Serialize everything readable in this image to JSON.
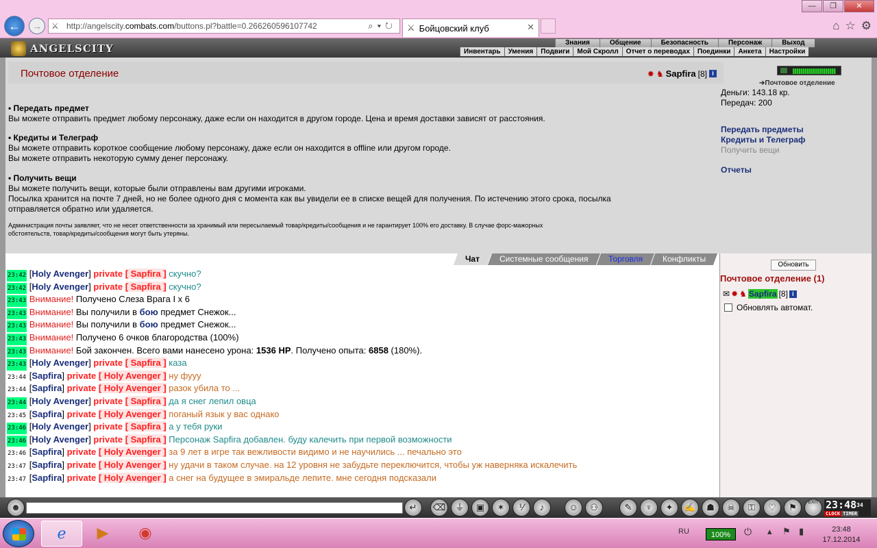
{
  "browser": {
    "url_prefix": "http://angelscity.",
    "url_host": "combats.com",
    "url_rest": "/buttons.pl?battle=0.266260596107742",
    "tab_title": "Бойцовский клуб"
  },
  "game": {
    "logo": "ANGELSCITY",
    "main_menu": [
      "Знания",
      "Общение",
      "Безопасность",
      "Персонаж",
      "Выход"
    ],
    "sub_menu": [
      "Инвентарь",
      "Умения",
      "Подвиги",
      "Мой Скролл",
      "Отчет о переводах",
      "Поединки",
      "Анкета",
      "Настройки"
    ]
  },
  "page": {
    "title": "Почтовое отделение",
    "player_name": "Sapfira",
    "player_level": "[8]",
    "info": "i",
    "sections": [
      {
        "heading": "• Передать предмет",
        "lines": [
          "Вы можете отправить предмет любому персонажу, даже если он находится в другом городе. Цена и время доставки зависят от расстояния."
        ]
      },
      {
        "heading": "• Кредиты и Телеграф",
        "lines": [
          "Вы можете отправить короткое сообщение любому персонажу, даже если он находится в offline или другом городе.",
          "Вы можете отправить некоторую сумму денег персонажу."
        ]
      },
      {
        "heading": "• Получить вещи",
        "lines": [
          "Вы можете получить вещи, которые были отправлены вам другими игроками.",
          "Посылка хранится на почте 7 дней, но не более одного дня с момента как вы увидели ее в списке вещей для получения. По истечению этого срока, посылка",
          "отправляется обратно или удаляется."
        ]
      }
    ],
    "disclaimer_1": "Администрация почты заявляет, что не несет ответственности за хранимый или пересылаемый товар/кредиты/сообщения и не гарантирует 100% его доставку. В случае форс-мажорных",
    "disclaimer_2": "обстоятельств, товар/кредиты/сообщения могут быть утеряны."
  },
  "side": {
    "hp_fill": 0.92,
    "location_tag": "Почтовое отделение",
    "money": "Деньги: 143.18 кр.",
    "transfers": "Передач: 200",
    "link_transfer": "Передать предметы",
    "link_credits": "Кредиты и Телеграф",
    "link_receive": "Получить вещи",
    "link_reports": "Отчеты"
  },
  "chat": {
    "tabs": [
      "Чат",
      "Системные сообщения",
      "Торговля",
      "Конфликты"
    ],
    "messages": [
      {
        "ts": "23:42",
        "green": true,
        "type": "to",
        "from": "Holy Avenger",
        "to": "Sapfira",
        "text": "скучно?",
        "color": "teal"
      },
      {
        "ts": "23:42",
        "green": true,
        "type": "to",
        "from": "Holy Avenger",
        "to": "Sapfira",
        "text": "скучно?",
        "color": "teal"
      },
      {
        "ts": "23:43",
        "green": true,
        "type": "warn",
        "text": "Получено Слеза Врага I x 6"
      },
      {
        "ts": "23:43",
        "green": true,
        "type": "warn_boy",
        "pre": "Вы получили в ",
        "boy": "бою",
        "post": " предмет Снежок..."
      },
      {
        "ts": "23:43",
        "green": true,
        "type": "warn_boy",
        "pre": "Вы получили в ",
        "boy": "бою",
        "post": " предмет Снежок..."
      },
      {
        "ts": "23:43",
        "green": true,
        "type": "warn",
        "text": "Получено 6 очков благородства (100%)"
      },
      {
        "ts": "23:43",
        "green": true,
        "type": "warn_battle",
        "pre": "Бой закончен. Всего вами нанесено урона: ",
        "dmg": "1536 HP",
        "mid": ". Получено опыта: ",
        "exp": "6858",
        "post": " (180%)."
      },
      {
        "ts": "23:43",
        "green": true,
        "type": "to",
        "from": "Holy Avenger",
        "to": "Sapfira",
        "text": "каза",
        "color": "teal"
      },
      {
        "ts": "23:44",
        "green": false,
        "type": "to",
        "from": "Sapfira",
        "to": "Holy Avenger",
        "text": "ну фууу",
        "color": "orange"
      },
      {
        "ts": "23:44",
        "green": false,
        "type": "to",
        "from": "Sapfira",
        "to": "Holy Avenger",
        "text": "разок убила то ...",
        "color": "orange"
      },
      {
        "ts": "23:44",
        "green": true,
        "type": "to",
        "from": "Holy Avenger",
        "to": "Sapfira",
        "text": "да я снег лепил овца",
        "color": "teal"
      },
      {
        "ts": "23:45",
        "green": false,
        "type": "to",
        "from": "Sapfira",
        "to": "Holy Avenger",
        "text": "поганый язык у вас однако",
        "color": "orange"
      },
      {
        "ts": "23:46",
        "green": true,
        "type": "to",
        "from": "Holy Avenger",
        "to": "Sapfira",
        "text": "а у тебя руки",
        "color": "teal"
      },
      {
        "ts": "23:46",
        "green": true,
        "type": "to",
        "from": "Holy Avenger",
        "to": "Sapfira",
        "text": "Персонаж Sapfira добавлен. буду калечить при первой возможности",
        "color": "teal"
      },
      {
        "ts": "23:46",
        "green": false,
        "type": "to",
        "from": "Sapfira",
        "to": "Holy Avenger",
        "text": "за 9 лет в игре так вежливости видимо и не научились ... печально это",
        "color": "orange"
      },
      {
        "ts": "23:47",
        "green": false,
        "type": "to",
        "from": "Sapfira",
        "to": "Holy Avenger",
        "text": "ну удачи в таком случае. на 12 уровня не забудьте переключится, чтобы уж наверняка искалечить",
        "color": "orange"
      },
      {
        "ts": "23:47",
        "green": false,
        "type": "to",
        "from": "Sapfira",
        "to": "Holy Avenger",
        "text": "а снег на будущее в эмиральде лепите. мне сегодня подсказали",
        "color": "orange"
      }
    ],
    "warning_label": "Внимание!",
    "private_label": "private",
    "refresh": "Обновить",
    "room_title": "Почтовое отделение (1)",
    "room_user": "Sapfira",
    "room_user_level": "[8]",
    "auto_refresh": "Обновлять автомат."
  },
  "clock": {
    "time": "23:48",
    "sec": "34",
    "lbl_clock": "CLOCK",
    "lbl_timer": "TIMER",
    "exit": "EXIT"
  },
  "taskbar": {
    "lang": "RU",
    "battery": "100%",
    "time": "23:48",
    "date": "17.12.2014"
  }
}
